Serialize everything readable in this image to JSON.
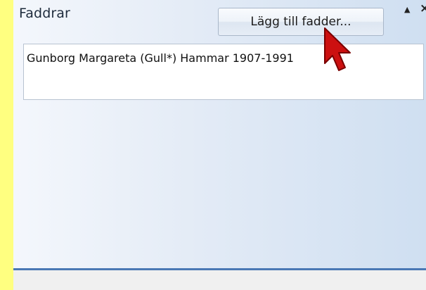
{
  "panel": {
    "title": "Faddrar",
    "add_button_label": "Lägg till fadder...",
    "collapse_icon": "▲",
    "close_icon": "×"
  },
  "list": {
    "items": [
      {
        "label": "Gunborg Margareta (Gull*) Hammar 1907-1991"
      }
    ]
  },
  "colors": {
    "background": "#ffff80",
    "accent_divider": "#4a78b4",
    "cursor": "#cc1010"
  }
}
